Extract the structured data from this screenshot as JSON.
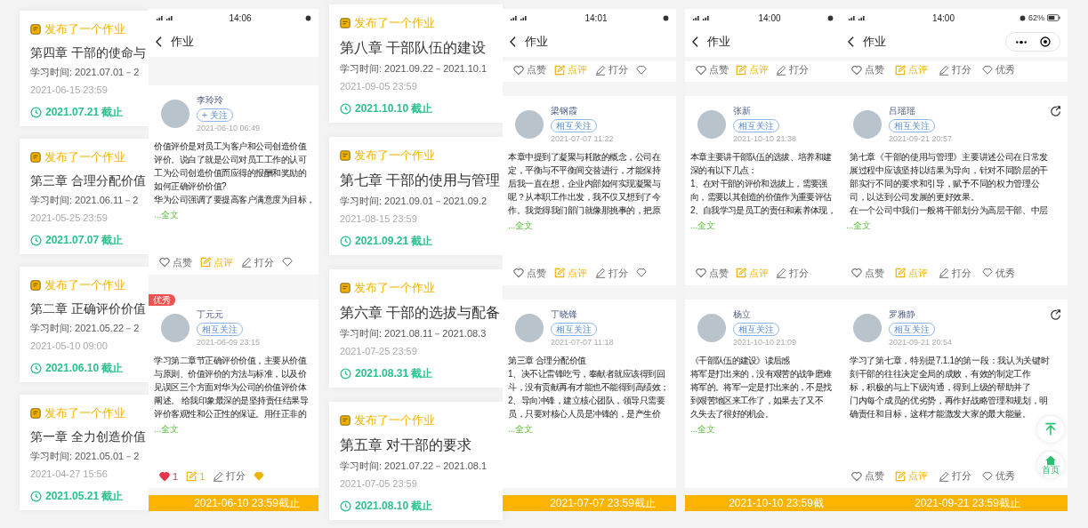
{
  "panels": [
    {
      "kind": "assignments",
      "cards": [
        {
          "tag": "发布了一个作业",
          "title": "第四章 干部的使命与",
          "study_time": "学习时间: 2021.07.01－2",
          "published": "2021-06-15 23:59",
          "deadline": "2021.07.21 截止"
        },
        {
          "tag": "发布了一个作业",
          "title": "第三章 合理分配价值",
          "study_time": "学习时间: 2021.06.11－2",
          "published": "2021-05-25 23:59",
          "deadline": "2021.07.07 截止"
        },
        {
          "tag": "发布了一个作业",
          "title": "第二章 正确评价价值",
          "study_time": "学习时间: 2021.05.22－2",
          "published": "2021-05-10 09:00",
          "deadline": "2021.06.10 截止"
        },
        {
          "tag": "发布了一个作业",
          "title": "第一章 全力创造价值",
          "study_time": "学习时间: 2021.05.01－2",
          "published": "2021-04-27 15:56",
          "deadline": "2021.05.21 截止"
        }
      ]
    },
    {
      "kind": "phone",
      "status_time": "14:06",
      "title": "作业",
      "posts": [
        {
          "name": "李玲玲",
          "follow": "+ 关注",
          "date": "2021-06-10 06:49",
          "lines": [
            "价值评价是对员工为客户和公司创造价值",
            "评价。说白了就是公司对员工工作的认可",
            "工为公司创造价值而应得的报酬和奖励的",
            "如何正确评价价值?",
            "华为公司强调了要提高客户满意度为目标，"
          ],
          "more": "...全文",
          "actions": [
            {
              "kind": "like",
              "label": "点赞",
              "active": false
            },
            {
              "kind": "comment",
              "label": "点评"
            },
            {
              "kind": "score",
              "label": "打分"
            },
            {
              "kind": "excellent",
              "active": false
            }
          ]
        },
        {
          "name": "丁元元",
          "follow": "相互关注",
          "date": "2021-06-09 23:15",
          "badge": "优秀",
          "lines": [
            "学习第二章节正确评价价值，主要从价值",
            "与原则、价值评价的方法与标准，以及价",
            "见误区三个方面对华为公司的价值评价体",
            "阐述。 给我印象最深的是坚持责任结果导",
            "评价客观性和公正性的保证。用任正非的"
          ],
          "more": "...全文",
          "actions": [
            {
              "kind": "like",
              "label": "1",
              "active": true
            },
            {
              "kind": "comment",
              "label": "1"
            },
            {
              "kind": "score",
              "label": "打分"
            },
            {
              "kind": "excellent",
              "active": true
            }
          ]
        }
      ],
      "footer": "2021-06-10 23:59截止"
    },
    {
      "kind": "assignments",
      "cards": [
        {
          "tag": "发布了一个作业",
          "title": "第八章 干部队伍的建设",
          "study_time": "学习时间: 2021.09.22－2021.10.1",
          "published": "2021-09-05 23:59",
          "deadline": "2021.10.10 截止"
        },
        {
          "tag": "发布了一个作业",
          "title": "第七章 干部的使用与管理",
          "study_time": "学习时间: 2021.09.01－2021.09.2",
          "published": "2021-08-15 23:59",
          "deadline": "2021.09.21 截止"
        },
        {
          "tag": "发布了一个作业",
          "title": "第六章 干部的选拔与配备",
          "study_time": "学习时间: 2021.08.11－2021.08.3",
          "published": "2021-07-25 23:59",
          "deadline": "2021.08.31 截止"
        },
        {
          "tag": "发布了一个作业",
          "title": "第五章 对干部的要求",
          "study_time": "学习时间: 2021.07.22－2021.08.1",
          "published": "2021-07-05 23:59",
          "deadline": "2021.08.10 截止"
        }
      ]
    },
    {
      "kind": "phone",
      "status_time": "14:01",
      "title": "作业",
      "top_actions": [
        {
          "kind": "like",
          "label": "点赞",
          "active": false
        },
        {
          "kind": "comment",
          "label": "点评"
        },
        {
          "kind": "score",
          "label": "打分"
        },
        {
          "kind": "excellent",
          "active": false
        }
      ],
      "posts": [
        {
          "name": "梁钢霞",
          "follow": "相互关注",
          "date": "2021-07-07 11:22",
          "lines": [
            "本章中提到了凝聚与耗散的概念，公司在",
            "定，平衡与不平衡间交替进行，才能保持",
            "后我一直在想，企业内部如何实现凝聚与",
            "呢？从本职工作出发，我不仅又想到了今",
            "作。我觉得我们部门就像那挑事的，把原"
          ],
          "more": "...全文",
          "actions": [
            {
              "kind": "like",
              "label": "点赞",
              "active": false
            },
            {
              "kind": "comment",
              "label": "点评"
            },
            {
              "kind": "score",
              "label": "打分"
            },
            {
              "kind": "excellent",
              "active": false
            }
          ]
        },
        {
          "name": "丁晓锋",
          "follow": "相互关注",
          "date": "2021-07-07 11:18",
          "lines": [
            "第三章 合理分配价值",
            "1、决不让雷锋吃亏，奉献者就应该得到回",
            "斗，没有贡献再有才能也不能得到高绩效；",
            "2、导向冲锋，建立核心团队，领导只需要",
            "员，只要对核心人员是冲锋的，是产生价"
          ],
          "more": "...全文"
        }
      ],
      "footer": "2021-07-07 23:59截止"
    },
    {
      "kind": "phone",
      "status_time": "14:00",
      "title": "作业",
      "top_actions": [
        {
          "kind": "like",
          "label": "点赞",
          "active": false
        },
        {
          "kind": "comment",
          "label": "点评"
        },
        {
          "kind": "score",
          "label": "打分"
        }
      ],
      "posts": [
        {
          "name": "张新",
          "follow": "相互关注",
          "date": "2021-10-10 21:38",
          "lines": [
            "本章主要讲干部队伍的选拔、培养和建",
            "深的有以下几点：",
            "1、在对干部的评价和选拔上，需要强",
            "向，需要以其创造的价值作为重要评估",
            "2、自我学习是员工的责任和素养体现，"
          ],
          "more": "...全文",
          "actions": [
            {
              "kind": "like",
              "label": "点赞",
              "active": false
            },
            {
              "kind": "comment",
              "label": "点评"
            },
            {
              "kind": "score",
              "label": "打分"
            }
          ]
        },
        {
          "name": "杨立",
          "follow": "相互关注",
          "date": "2021-10-10 21:09",
          "lines": [
            "《干部队伍的建设》读后感",
            "将军是打出来的，没有艰苦的战争磨难",
            "将军的。将军一定是打出来的，不是找",
            "到艰苦地区来工作了，如果去了又不",
            "久失去了很好的机会。"
          ],
          "more": "...全文"
        }
      ],
      "footer": "2021-10-10 23:59截"
    },
    {
      "kind": "phone",
      "status_time": "14:00",
      "battery": "62%",
      "capsule": true,
      "title": "作业",
      "top_actions": [
        {
          "kind": "like",
          "label": "点赞",
          "active": false
        },
        {
          "kind": "comment",
          "label": "点评"
        },
        {
          "kind": "score",
          "label": "打分"
        },
        {
          "kind": "excellent",
          "label": "优秀",
          "active": false
        }
      ],
      "posts": [
        {
          "name": "吕瑶瑶",
          "follow": "相互关注",
          "date": "2021-09-21 20:57",
          "share": true,
          "lines": [
            "第七章《干部的使用与管理》主要讲述公司在日常发",
            "展过程中应该坚持以结果为导向，针对不同阶层的干",
            "部实行不同的要求和引导，赋予不同的权力管理公",
            "司，以达到公司发展的更好效果。",
            "在一个公司中我们一般将干部划分为高层干部、中层"
          ],
          "more": "...全文",
          "actions": [
            {
              "kind": "like",
              "label": "点赞",
              "active": false
            },
            {
              "kind": "comment",
              "label": "点评"
            },
            {
              "kind": "score",
              "label": "打分"
            },
            {
              "kind": "excellent",
              "label": "优秀",
              "active": false
            }
          ]
        },
        {
          "name": "罗雅静",
          "follow": "相互关注",
          "date": "2021-09-21 20:54",
          "share": true,
          "lines": [
            "学习了第七章，特别是7.1.1的第一段：我认为关键时",
            "刻干部的往往决定全局的成败，有效的制定工作",
            "标，积极的与上下级沟通，得到上级的帮助并了",
            "门内每个成员的优劣势，再作好战略管理和规划，明",
            "确责任和目标，这样才能激发大家的最大能量。"
          ],
          "actions": [
            {
              "kind": "like",
              "label": "点赞",
              "active": false
            },
            {
              "kind": "comment",
              "label": "点评"
            },
            {
              "kind": "score",
              "label": "打分"
            },
            {
              "kind": "excellent",
              "label": "优秀",
              "active": false
            }
          ]
        }
      ],
      "float_buttons": [
        {
          "kind": "top"
        },
        {
          "kind": "home",
          "label": "首页"
        }
      ],
      "footer": "2021-09-21 23:59截止"
    }
  ]
}
